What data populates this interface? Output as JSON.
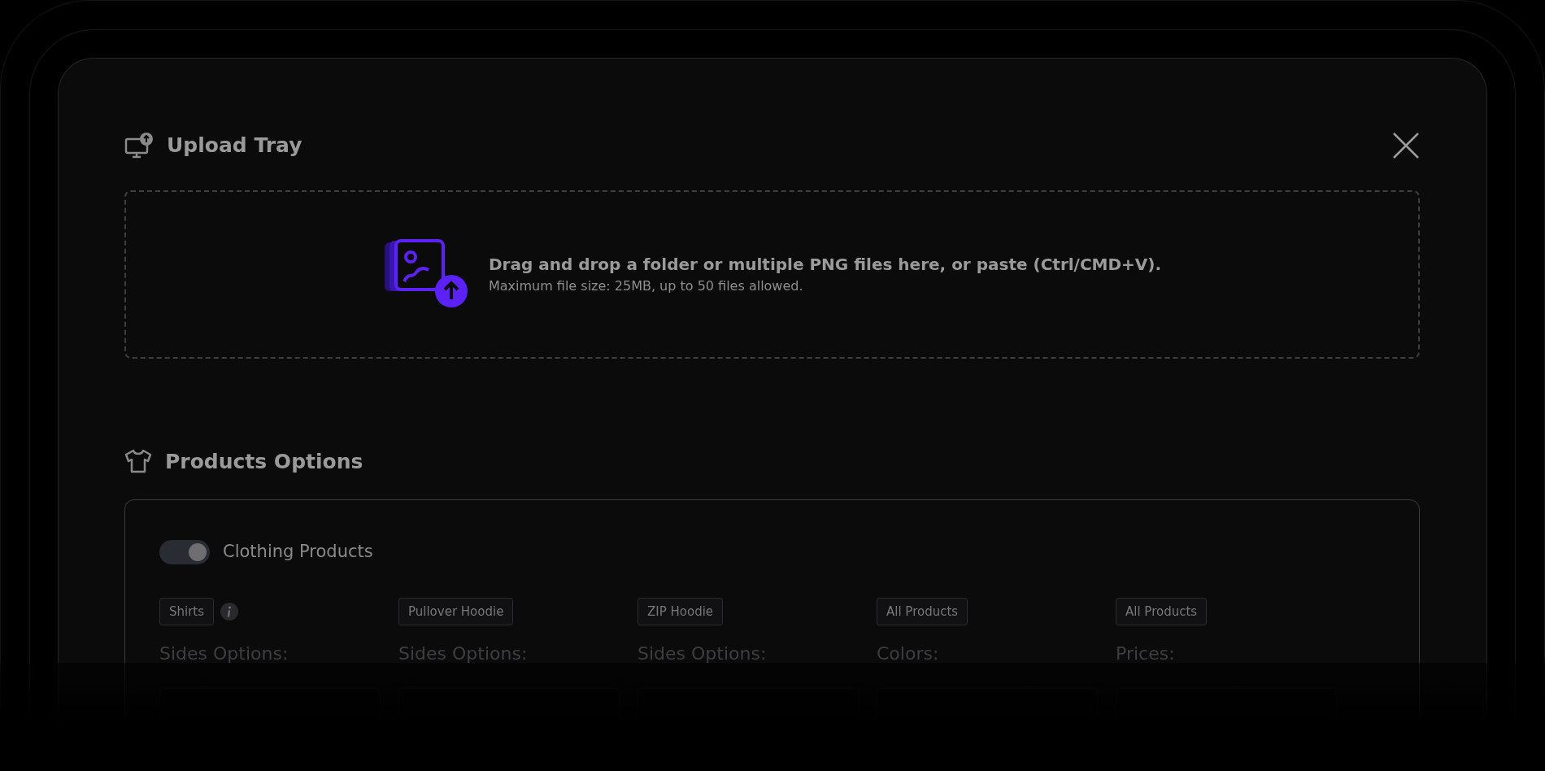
{
  "upload_tray": {
    "title": "Upload Tray",
    "dropzone": {
      "title": "Drag and drop a folder or multiple PNG files here, or paste (Ctrl/CMD+V).",
      "hint": "Maximum file size: 25MB, up to 50 files allowed."
    }
  },
  "products_options": {
    "title": "Products Options",
    "toggle": {
      "label": "Clothing Products",
      "on": true
    },
    "columns": [
      {
        "tag": "Shirts",
        "info": true,
        "label": "Sides Options:"
      },
      {
        "tag": "Pullover Hoodie",
        "info": false,
        "label": "Sides Options:"
      },
      {
        "tag": "ZIP Hoodie",
        "info": false,
        "label": "Sides Options:"
      },
      {
        "tag": "All Products",
        "info": false,
        "label": "Colors:"
      },
      {
        "tag": "All Products",
        "info": false,
        "label": "Prices:"
      }
    ]
  }
}
